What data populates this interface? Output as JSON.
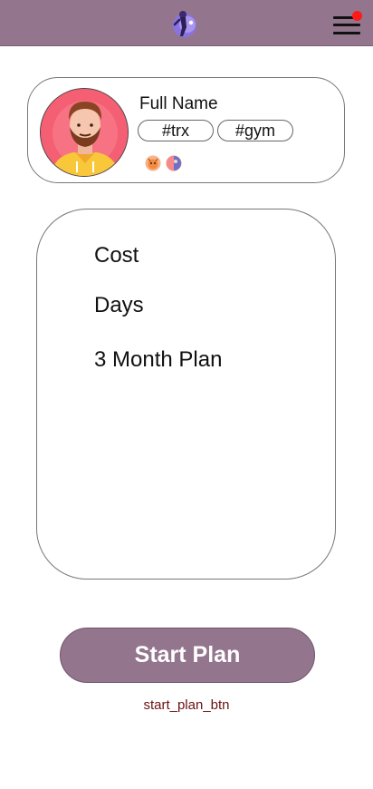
{
  "header": {
    "logo_icon": "fitness-person-icon",
    "menu_icon": "hamburger-menu-icon",
    "notification_color": "#ff1a1a",
    "bar_color": "#94758e"
  },
  "profile": {
    "name": "Full Name",
    "avatar_icon": "bearded-man-avatar",
    "tags": [
      "#trx",
      "#gym"
    ],
    "badges": [
      "tiger-badge-icon",
      "globe-badge-icon"
    ]
  },
  "plan": {
    "cost_label": "Cost",
    "days_label": "Days",
    "plan_name": "3 Month Plan"
  },
  "actions": {
    "start_label": "Start Plan",
    "start_caption": "start_plan_btn"
  }
}
